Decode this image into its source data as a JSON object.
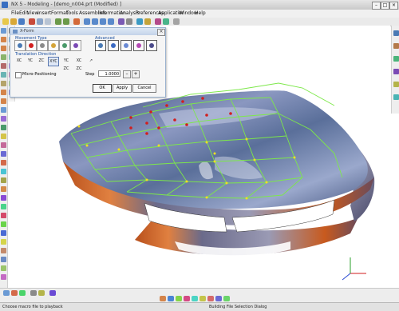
{
  "window": {
    "title": "NX 5 - Modeling - [demo_n004.prt (Modified) ]",
    "controls": {
      "minimize": "–",
      "maximize": "□",
      "close": "×"
    }
  },
  "menu": [
    "File",
    "Edit",
    "View",
    "Insert",
    "Format",
    "Tools",
    "Assemblies",
    "Information",
    "Analysis",
    "Preferences",
    "Application",
    "Window",
    "Help"
  ],
  "dialog": {
    "title": "X-Form",
    "movement_type_label": "Movement Type",
    "advanced_label": "Advanced",
    "translation_direction_label": "Translation Direction",
    "translation_options": [
      "XC",
      "YC",
      "ZC",
      "XYC",
      "YC ZC",
      "XC ZC"
    ],
    "selected_translation": "XYC",
    "micro_positioning_label": "Micro-Positioning",
    "micro_positioning_checked": false,
    "step_label": "Step",
    "step_value": "1.0000",
    "spin_minus": "–",
    "spin_plus": "+",
    "ok_label": "OK",
    "apply_label": "Apply",
    "cancel_label": "Cancel"
  },
  "status": {
    "left": "Choose macro file to playback",
    "center": "Building File Selection Dialog"
  },
  "icons": {
    "move": "move-icon",
    "rotate": "rotate-icon",
    "scale": "scale-icon",
    "smooth": "smooth-icon",
    "adv1": "advanced-tool-1-icon",
    "adv2": "advanced-tool-2-icon",
    "adv3": "advanced-tool-3-icon",
    "adv4": "advanced-tool-4-icon"
  },
  "colors": {
    "dialog_accent": "#1a4fa0",
    "control_grid": "#7de84a",
    "pole_red": "#d21e1e",
    "pole_yellow": "#f0e020",
    "surface_blue": "#5a6f9a",
    "surface_orange": "#c85a1e"
  }
}
